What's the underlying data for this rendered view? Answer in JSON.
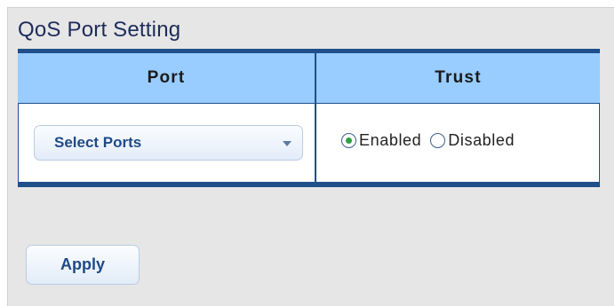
{
  "page": {
    "title": "QoS Port Setting"
  },
  "table": {
    "headers": {
      "port": "Port",
      "trust": "Trust"
    },
    "row": {
      "select_ports_label": "Select Ports",
      "trust_options": [
        {
          "label": "Enabled",
          "checked": true
        },
        {
          "label": "Disabled",
          "checked": false
        }
      ]
    }
  },
  "actions": {
    "apply_label": "Apply"
  },
  "colors": {
    "header_bg": "#99ccff",
    "border_dark_blue": "#1f4f8a",
    "title_text": "#1d2c5a",
    "button_text": "#1f4a87",
    "panel_bg": "#e6e6e6",
    "radio_checked": "#2ea043"
  }
}
